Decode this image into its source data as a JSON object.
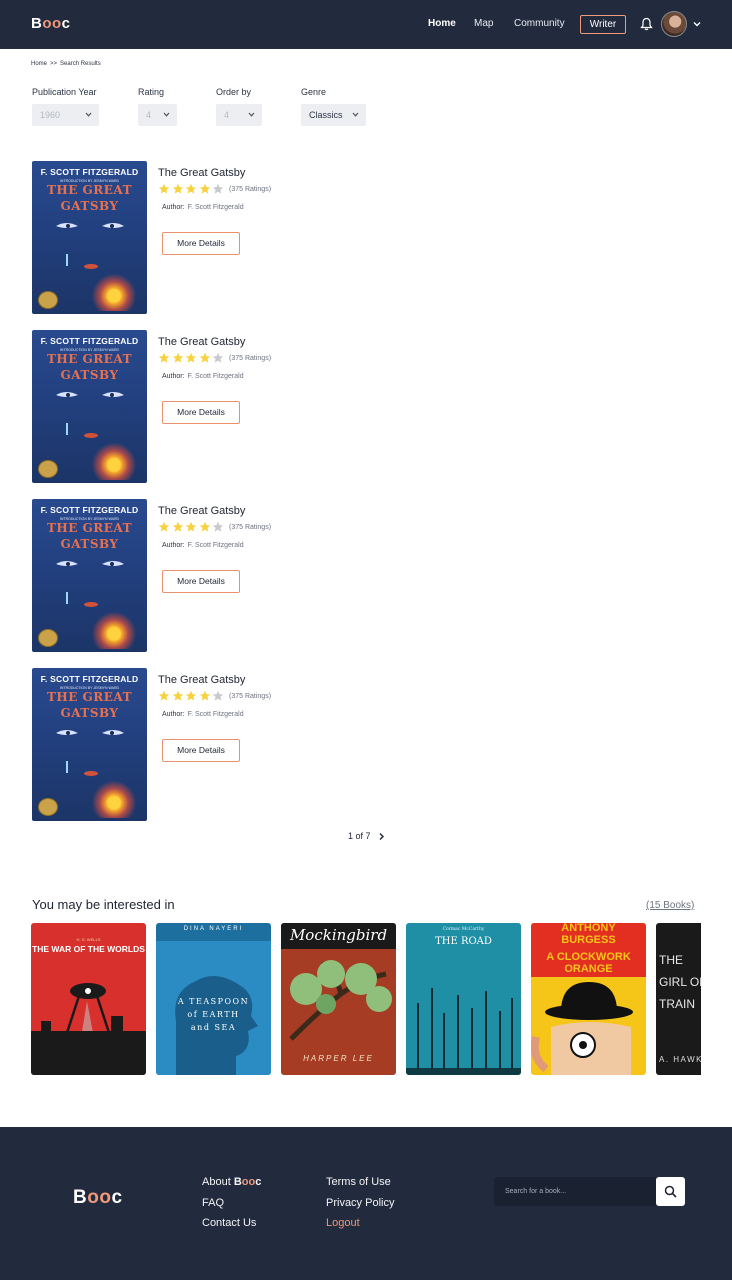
{
  "nav": {
    "logo_start": "B",
    "logo_mid": "oo",
    "logo_end": "c",
    "links": [
      "Home",
      "Map",
      "Community"
    ],
    "writer": "Writer"
  },
  "breadcrumb": [
    "Home",
    ">>",
    "Search Results"
  ],
  "filters": [
    {
      "label": "Publication Year",
      "value": "1960"
    },
    {
      "label": "Rating",
      "value": "4"
    },
    {
      "label": "Order by",
      "value": "4"
    },
    {
      "label": "Genre",
      "value": "Classics"
    }
  ],
  "cover": {
    "author": "F. SCOTT FITZGERALD",
    "intro": "INTRODUCTION BY JESMYN WARD",
    "title_line1": "THE GREAT",
    "title_line2": "GATSBY"
  },
  "books": [
    {
      "title": "The Great Gatsby",
      "rating": 4,
      "ratings_text": "(375 Ratings)",
      "author_label": "Author:",
      "author": "F. Scott Fitzgerald",
      "button": "More Details"
    },
    {
      "title": "The Great Gatsby",
      "rating": 4,
      "ratings_text": "(375 Ratings)",
      "author_label": "Author:",
      "author": "F. Scott Fitzgerald",
      "button": "More Details"
    },
    {
      "title": "The Great Gatsby",
      "rating": 4,
      "ratings_text": "(375 Ratings)",
      "author_label": "Author:",
      "author": "F. Scott Fitzgerald",
      "button": "More Details"
    },
    {
      "title": "The Great Gatsby",
      "rating": 4,
      "ratings_text": "(375 Ratings)",
      "author_label": "Author:",
      "author": "F. Scott Fitzgerald",
      "button": "More Details"
    }
  ],
  "pager": {
    "text": "1 of 7"
  },
  "interest": {
    "title": "You may be interested in",
    "count": "(15 Books)",
    "books": [
      {
        "label_top": "H. G. WELLS",
        "label_title": "THE WAR OF THE WORLDS",
        "color": "#d8302c"
      },
      {
        "label_top": "DINA NAYERI",
        "label_title": "A TEASPOON of EARTH and SEA",
        "color": "#1c6f9f"
      },
      {
        "label_top": "Mockingbird",
        "label_title": "HARPER LEE",
        "color": "#a63c23"
      },
      {
        "label_top": "Cormac McCarthy",
        "label_title": "THE ROAD",
        "color": "#1f8fa6"
      },
      {
        "label_top": "ANTHONY BURGESS",
        "label_title": "A CLOCKWORK ORANGE",
        "color": "#f5c518"
      },
      {
        "label_top": "THE",
        "label_title": "GIRL ON THE TRAIN",
        "label_bottom": "A. HAWK",
        "color": "#1a1a1a"
      }
    ]
  },
  "footer": {
    "about_prefix": "About ",
    "links_col1": [
      "FAQ",
      "Contact Us"
    ],
    "links_col2": [
      "Terms of Use",
      "Privacy Policy"
    ],
    "logout": "Logout",
    "search_placeholder": "Search for a book..."
  },
  "colors": {
    "navy": "#222b3d",
    "accent": "#f0987a",
    "star": "#f7d23e",
    "star_empty": "#c7c9ce"
  }
}
